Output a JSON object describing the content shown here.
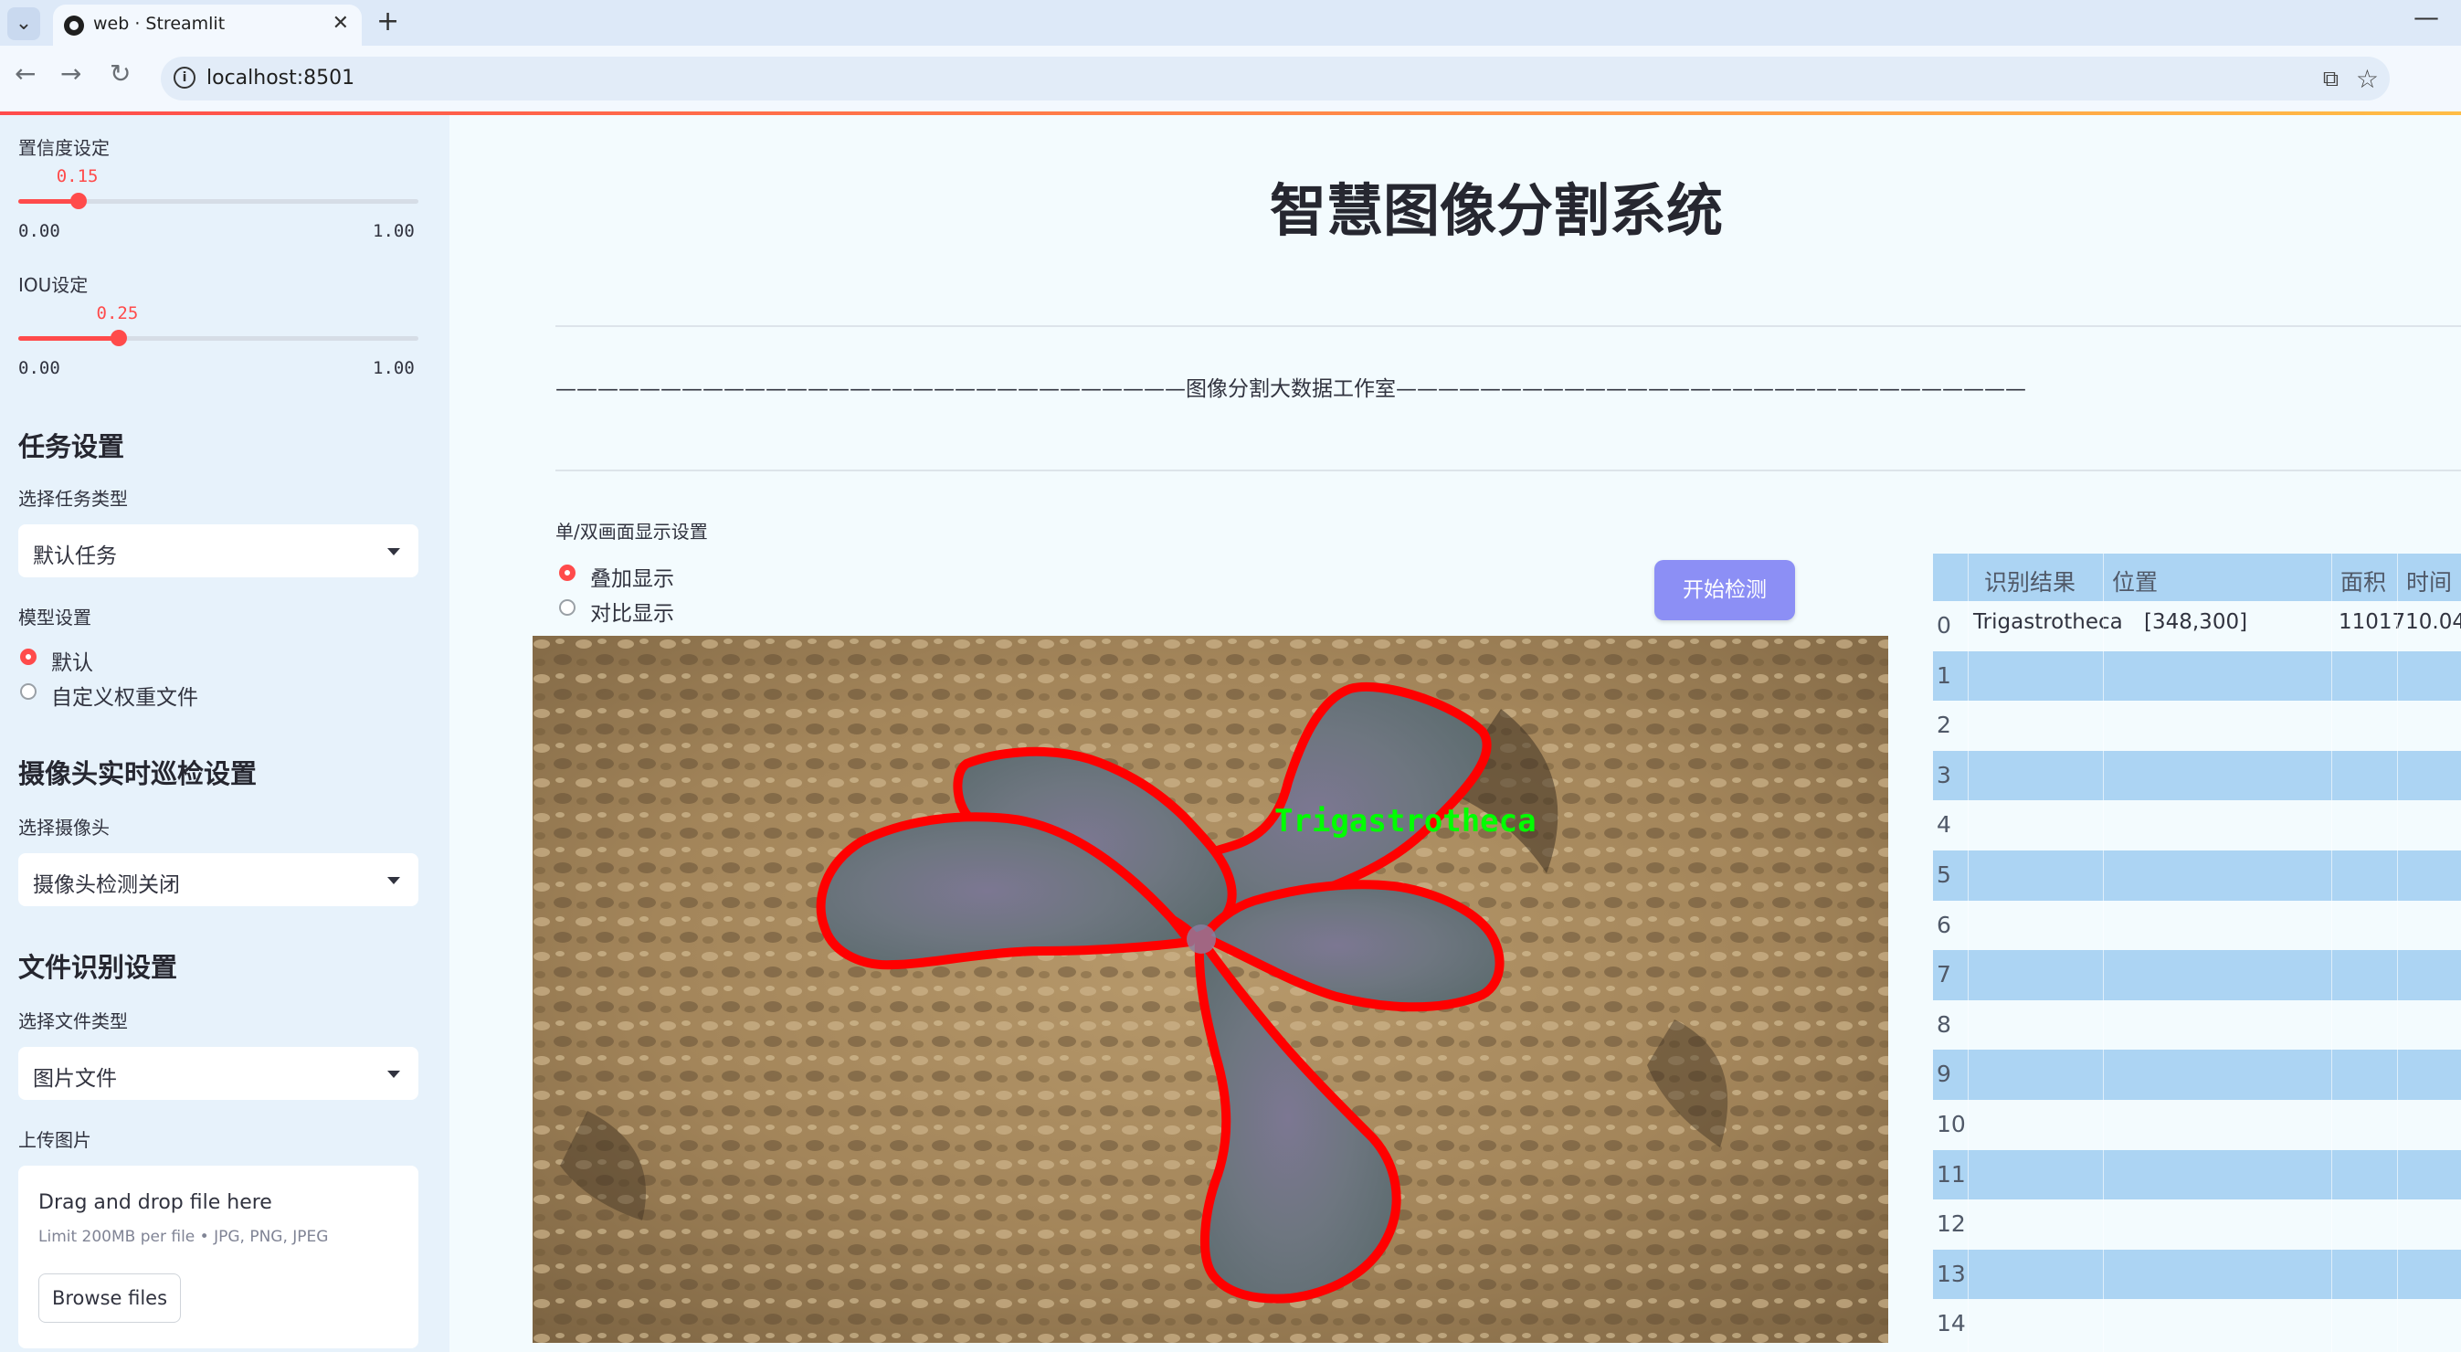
{
  "browser": {
    "tab_title": "web · Streamlit",
    "url": "localhost:8501"
  },
  "sidebar": {
    "confidence": {
      "label": "置信度设定",
      "value": "0.15",
      "value_fraction": 0.15,
      "min": "0.00",
      "max": "1.00"
    },
    "iou": {
      "label": "IOU设定",
      "value": "0.25",
      "value_fraction": 0.25,
      "min": "0.00",
      "max": "1.00"
    },
    "task_header": "任务设置",
    "task_type_label": "选择任务类型",
    "task_type_value": "默认任务",
    "model_label": "模型设置",
    "model_options": [
      "默认",
      "自定义权重文件"
    ],
    "model_selected": "默认",
    "camera_header": "摄像头实时巡检设置",
    "camera_label": "选择摄像头",
    "camera_value": "摄像头检测关闭",
    "file_header": "文件识别设置",
    "file_type_label": "选择文件类型",
    "file_type_value": "图片文件",
    "upload_label": "上传图片",
    "upload_title": "Drag and drop file here",
    "upload_limit": "Limit 200MB per file • JPG, PNG, JPEG",
    "browse_label": "Browse files"
  },
  "main": {
    "title": "智慧图像分割系统",
    "banner": "——————————————————————————————图像分割大数据工作室——————————————————————————————",
    "display_label": "单/双画面显示设置",
    "display_options": [
      "叠加显示",
      "对比显示"
    ],
    "display_selected": "叠加显示",
    "start_button": "开始检测",
    "detection_label": "Trigastrotheca"
  },
  "table": {
    "columns": [
      "识别结果",
      "位置",
      "面积",
      "时间"
    ],
    "rows": [
      {
        "index": "0",
        "result": "Trigastrotheca",
        "position": "[348,300]",
        "area": "1101710.04",
        "time": ""
      },
      {
        "index": "1"
      },
      {
        "index": "2"
      },
      {
        "index": "3"
      },
      {
        "index": "4"
      },
      {
        "index": "5"
      },
      {
        "index": "6"
      },
      {
        "index": "7"
      },
      {
        "index": "8"
      },
      {
        "index": "9"
      },
      {
        "index": "10"
      },
      {
        "index": "11"
      },
      {
        "index": "12"
      },
      {
        "index": "13"
      },
      {
        "index": "14"
      }
    ]
  },
  "colors": {
    "accent": "#ff4b4b",
    "button": "#8c8ff5",
    "table_stripe": "#acd4f3",
    "mask_outline": "#ff0000",
    "label_text": "#00ff00"
  }
}
